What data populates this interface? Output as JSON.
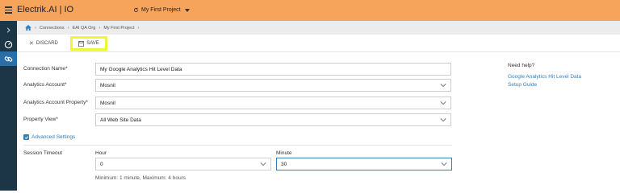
{
  "app": {
    "title": "Electrik.AI | IO",
    "project": "My First Project"
  },
  "breadcrumb": {
    "items": [
      "Connections",
      "EAI QA Org",
      "My First Project"
    ]
  },
  "toolbar": {
    "discard_label": "DISCARD",
    "save_label": "SAVE"
  },
  "form": {
    "connection_name": {
      "label": "Connection Name*",
      "value": "My Google Analytics Hit Level Data"
    },
    "account": {
      "label": "Analytics Account*",
      "value": "Mosnil"
    },
    "property": {
      "label": "Analytics Account Property*",
      "value": "Mosnil"
    },
    "view": {
      "label": "Property View*",
      "value": "All Web Site Data"
    },
    "advanced_label": "Advanced Settings",
    "session_timeout": {
      "label": "Session Timeout",
      "hour_label": "Hour",
      "hour_value": "0",
      "minute_label": "Minute",
      "minute_value": "30",
      "hint": "Minimum: 1 minute, Maximum: 4 hours"
    }
  },
  "help": {
    "title": "Need help?",
    "links": [
      "Google Analytics Hit Level Data",
      "Setup Guide"
    ]
  },
  "colors": {
    "topbar": "#f6a35b",
    "sidebar": "#1d3647",
    "accent": "#2f7fc1",
    "highlight": "#eef53a"
  }
}
